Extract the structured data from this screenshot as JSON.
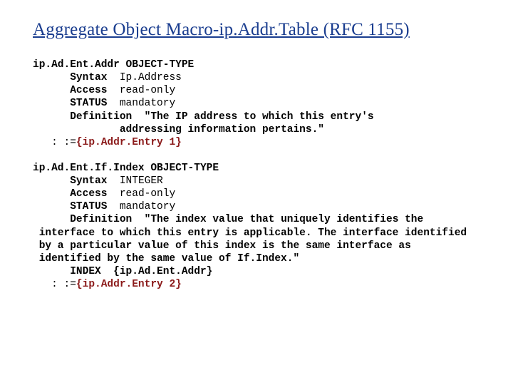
{
  "title": "Aggregate Object Macro-ip.Addr.Table (RFC 1155)",
  "b1": {
    "name": "ip.Ad.Ent.Addr",
    "objtype": "OBJECT-TYPE",
    "syntax_kw": "Syntax",
    "syntax_val": "Ip.Address",
    "access_kw": "Access",
    "access_val": "read-only",
    "status_kw": "STATUS",
    "status_val": "mandatory",
    "def_kw": "Definition",
    "def_l1": "\"The IP address to which this entry's",
    "def_l2": "addressing information pertains.\"",
    "assign_pre": ": :=",
    "assign_body": "{ip.Addr.Entry 1}"
  },
  "b2": {
    "name": "ip.Ad.Ent.If.Index",
    "objtype": "OBJECT-TYPE",
    "syntax_kw": "Syntax",
    "syntax_val": "INTEGER",
    "access_kw": "Access",
    "access_val": "read-only",
    "status_kw": "STATUS",
    "status_val": "mandatory",
    "def_kw": "Definition",
    "def_l1": "\"The index value that uniquely identifies the",
    "def_l2": "interface to which this entry is applicable. The interface identified",
    "def_l3": "by a particular value of this index is the same interface as",
    "def_l4": "identified by the same value of If.Index.\"",
    "index_kw": "INDEX",
    "index_val": "{ip.Ad.Ent.Addr}",
    "assign_pre": ": :=",
    "assign_body": "{ip.Addr.Entry 2}"
  }
}
